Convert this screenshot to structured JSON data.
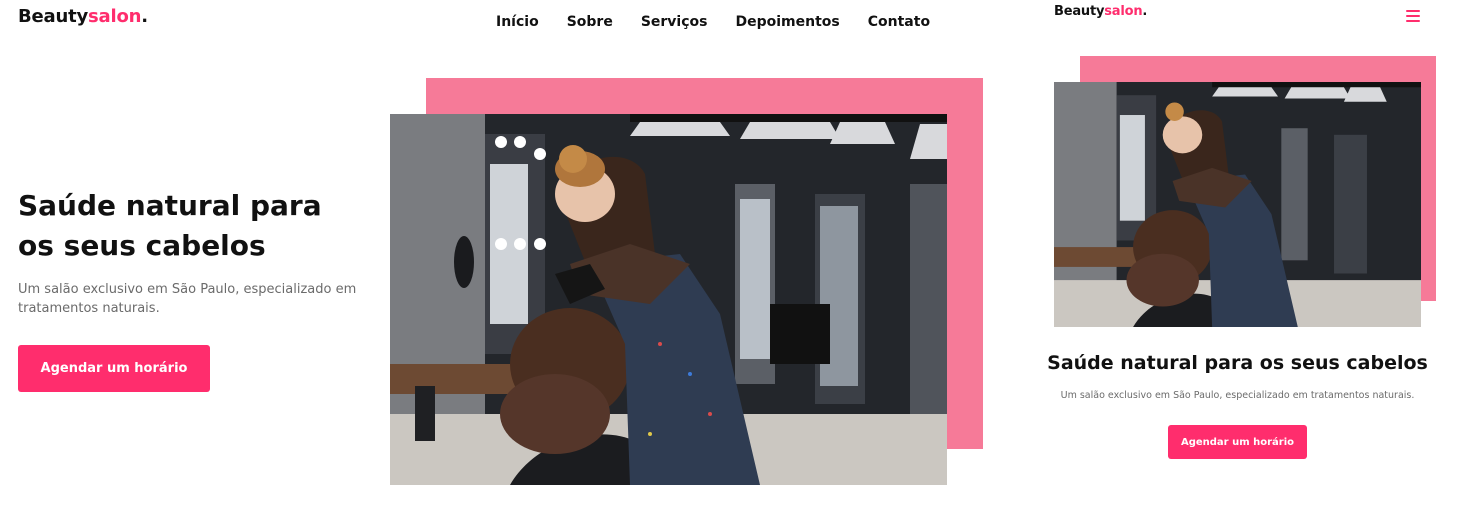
{
  "brand": {
    "name_main": "Beauty",
    "name_accent": "salon",
    "name_dot": ".",
    "accent_color": "#ff2d6d"
  },
  "nav": {
    "items": [
      {
        "label": "Início"
      },
      {
        "label": "Sobre"
      },
      {
        "label": "Serviços"
      },
      {
        "label": "Depoimentos"
      },
      {
        "label": "Contato"
      }
    ]
  },
  "hero": {
    "title": "Saúde natural para os seus cabelos",
    "subtitle": "Um salão exclusivo em São Paulo, especializado em tratamentos naturais.",
    "cta_label": "Agendar um horário",
    "image_alt_icon": "salon-photo",
    "decor_color": "#f67a98"
  },
  "mobile": {
    "menu_icon": "hamburger-menu-icon"
  }
}
